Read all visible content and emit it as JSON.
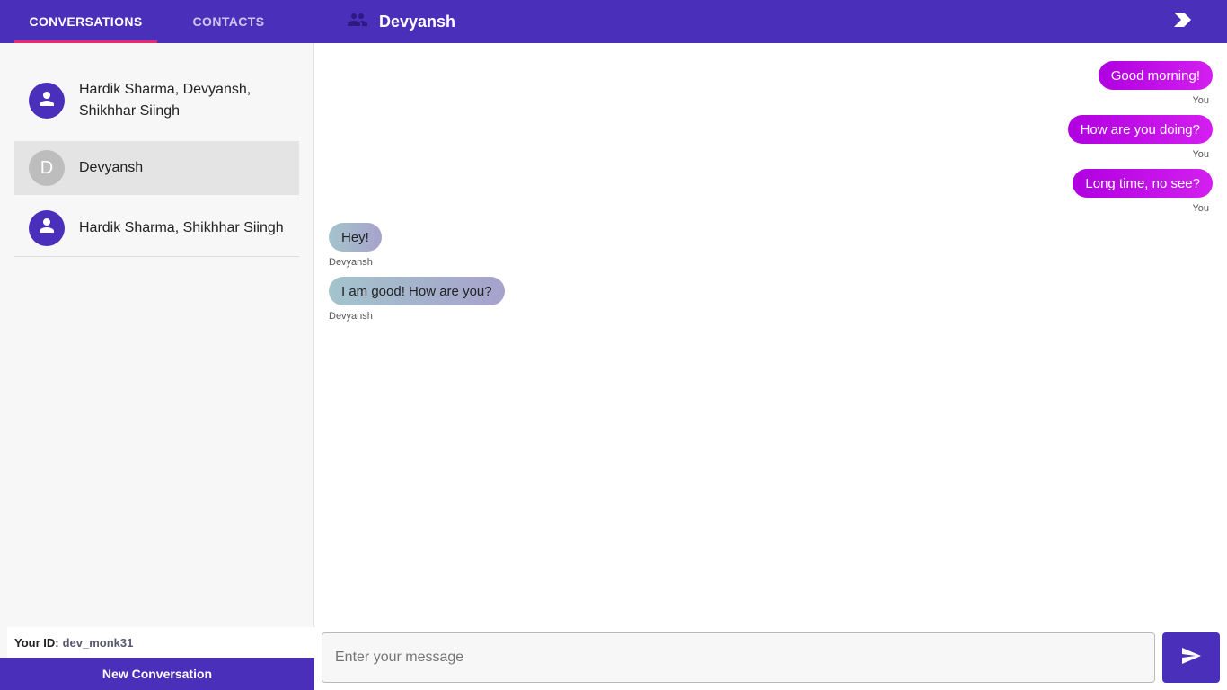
{
  "colors": {
    "accent": "#4a2fba",
    "tab_indicator": "#f0266b",
    "sent_bubble": "#c010e8",
    "received_bubble": "#a5b4cc"
  },
  "tabs": [
    {
      "label": "CONVERSATIONS",
      "active": true
    },
    {
      "label": "CONTACTS",
      "active": false
    }
  ],
  "chat_header": {
    "icon": "people-icon",
    "title": "Devyansh"
  },
  "collapse_icon": "chevron-right-icon",
  "conversations": [
    {
      "name": "Hardik Sharma, Devyansh, Shikhhar Siingh",
      "avatar_icon": "person-icon",
      "selected": false
    },
    {
      "name": "Devyansh",
      "avatar_letter": "D",
      "selected": true
    },
    {
      "name": "Hardik Sharma, Shikhhar Siingh",
      "avatar_icon": "person-icon",
      "selected": false
    }
  ],
  "user": {
    "id_label": "Your ID:",
    "id_value": "dev_monk31"
  },
  "new_conversation_label": "New Conversation",
  "messages": [
    {
      "text": "Good morning!",
      "sender": "You",
      "from_me": true
    },
    {
      "text": "How are you doing?",
      "sender": "You",
      "from_me": true
    },
    {
      "text": "Long time, no see?",
      "sender": "You",
      "from_me": true
    },
    {
      "text": "Hey!",
      "sender": "Devyansh",
      "from_me": false
    },
    {
      "text": "I am good! How are you?",
      "sender": "Devyansh",
      "from_me": false
    }
  ],
  "composer": {
    "placeholder": "Enter your message",
    "value": "",
    "send_icon": "send-icon"
  }
}
